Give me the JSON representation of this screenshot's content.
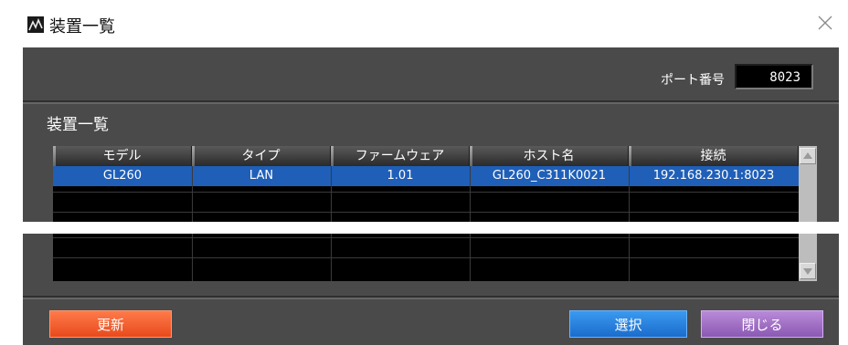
{
  "window": {
    "title": "装置一覧"
  },
  "port": {
    "label": "ポート番号",
    "value": "8023"
  },
  "section_title": "装置一覧",
  "table": {
    "columns": [
      "モデル",
      "タイプ",
      "ファームウェア",
      "ホスト名",
      "接続"
    ],
    "rows": [
      [
        "GL260",
        "LAN",
        "1.01",
        "GL260_C311K0021",
        "192.168.230.1:8023"
      ]
    ]
  },
  "buttons": {
    "refresh": "更新",
    "select": "選択",
    "close": "閉じる"
  },
  "colors": {
    "body_bg": "#4a4a4a",
    "selected_row": "#1f5fb8",
    "refresh": "#f05a28",
    "select": "#2c84e0",
    "close": "#a876c9"
  },
  "icons": {
    "app": "app-logo-icon",
    "close": "close-icon",
    "up": "scroll-up-icon",
    "down": "scroll-down-icon"
  }
}
